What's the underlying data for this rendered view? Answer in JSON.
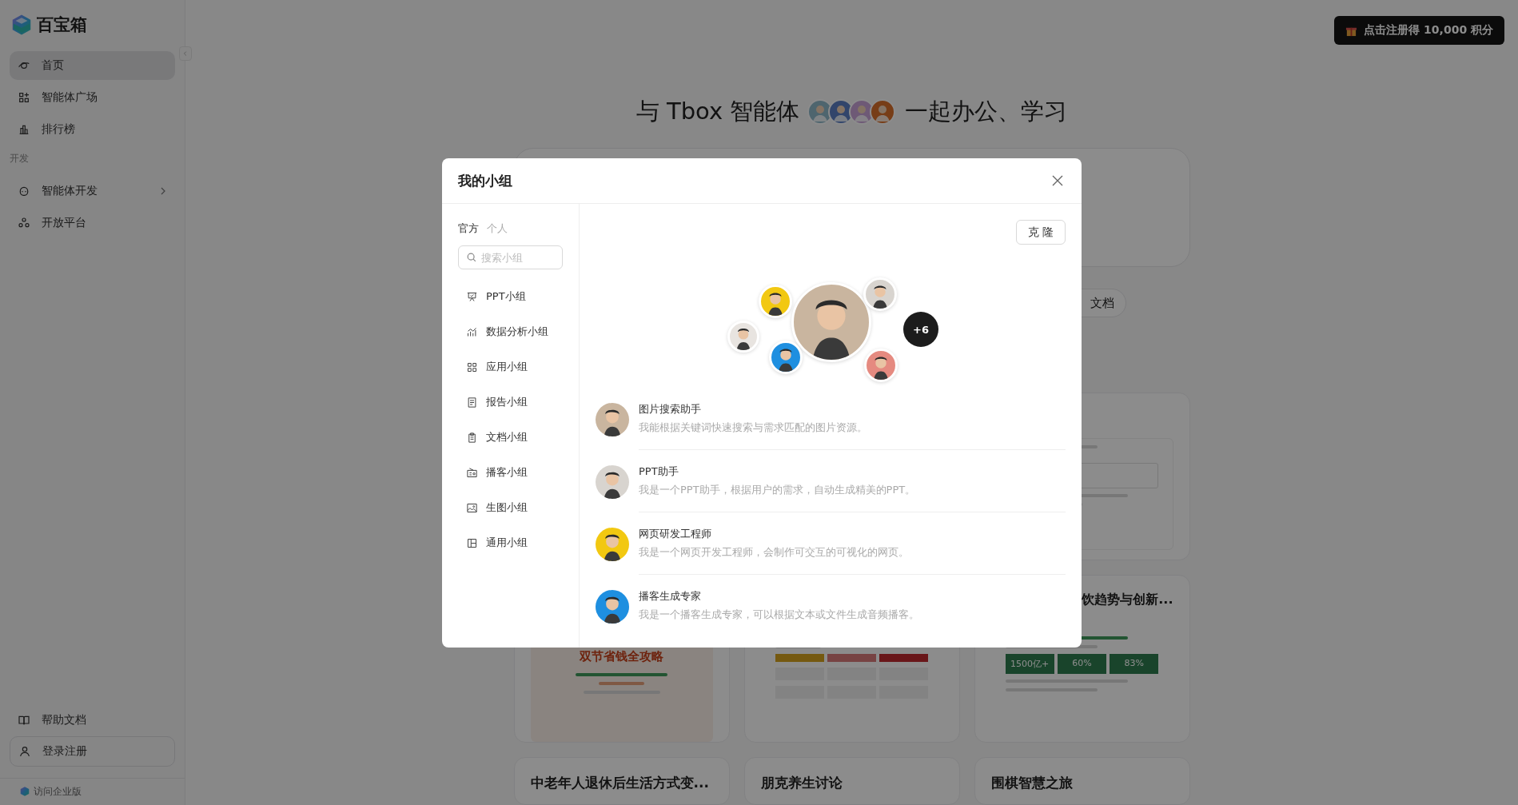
{
  "sidebar": {
    "logo": "百宝箱",
    "nav": [
      {
        "label": "首页",
        "selected": true
      },
      {
        "label": "智能体广场",
        "selected": false
      },
      {
        "label": "排行榜",
        "selected": false
      }
    ],
    "dev_section": {
      "label": "开发",
      "items": [
        {
          "label": "智能体开发",
          "submenu": true
        },
        {
          "label": "开放平台",
          "submenu": false
        }
      ]
    },
    "help": "帮助文档",
    "login": "登录注册",
    "enterprise": "访问企业版"
  },
  "promo_button": "点击注册得 10,000 积分",
  "hero": {
    "before": "与 Tbox 智能体",
    "after": "一起办公、学习"
  },
  "chip": "文档",
  "cards": {
    "row_1": [
      {
        "kind": "doc"
      }
    ],
    "row_2": [
      {
        "kind": "poster",
        "heading": "双节省钱全攻略"
      },
      {
        "kind": "dashboard"
      },
      {
        "kind": "stats",
        "title": "饮趋势与创新...",
        "stats": [
          "1500亿+",
          "60%",
          "83%"
        ]
      }
    ],
    "row_3": [
      {
        "title": "中老年人退休后生活方式变..."
      },
      {
        "title": "朋克养生讨论"
      },
      {
        "title": "围棋智慧之旅"
      }
    ]
  },
  "dialog": {
    "title": "我的小组",
    "tabs": [
      {
        "label": "官方",
        "selected": true
      },
      {
        "label": "个人",
        "selected": false
      }
    ],
    "search": {
      "placeholder": "搜索小组"
    },
    "groups": [
      {
        "label": "PPT小组"
      },
      {
        "label": "数据分析小组"
      },
      {
        "label": "应用小组"
      },
      {
        "label": "报告小组"
      },
      {
        "label": "文档小组"
      },
      {
        "label": "播客小组"
      },
      {
        "label": "生图小组"
      },
      {
        "label": "通用小组"
      }
    ],
    "clone_button": "克 隆",
    "cluster": {
      "avatars": [
        {
          "color": "#c9b59f"
        },
        {
          "color": "#f2c811"
        },
        {
          "color": "#d8d4cf"
        },
        {
          "color": "#e8e4e0"
        },
        {
          "color": "#1e8fe0"
        },
        {
          "color": "#e58a80"
        }
      ],
      "more": "+6"
    },
    "agents": [
      {
        "name": "图片搜索助手",
        "description": "我能根据关键词快速搜索与需求匹配的图片资源。",
        "color": "#c9b59f"
      },
      {
        "name": "PPT助手",
        "description": "我是一个PPT助手，根据用户的需求，自动生成精美的PPT。",
        "color": "#d8d4cf"
      },
      {
        "name": "网页研发工程师",
        "description": "我是一个网页开发工程师，会制作可交互的可视化的网页。",
        "color": "#f2c811"
      },
      {
        "name": "播客生成专家",
        "description": "我是一个播客生成专家，可以根据文本或文件生成音频播客。",
        "color": "#1e8fe0"
      }
    ]
  }
}
